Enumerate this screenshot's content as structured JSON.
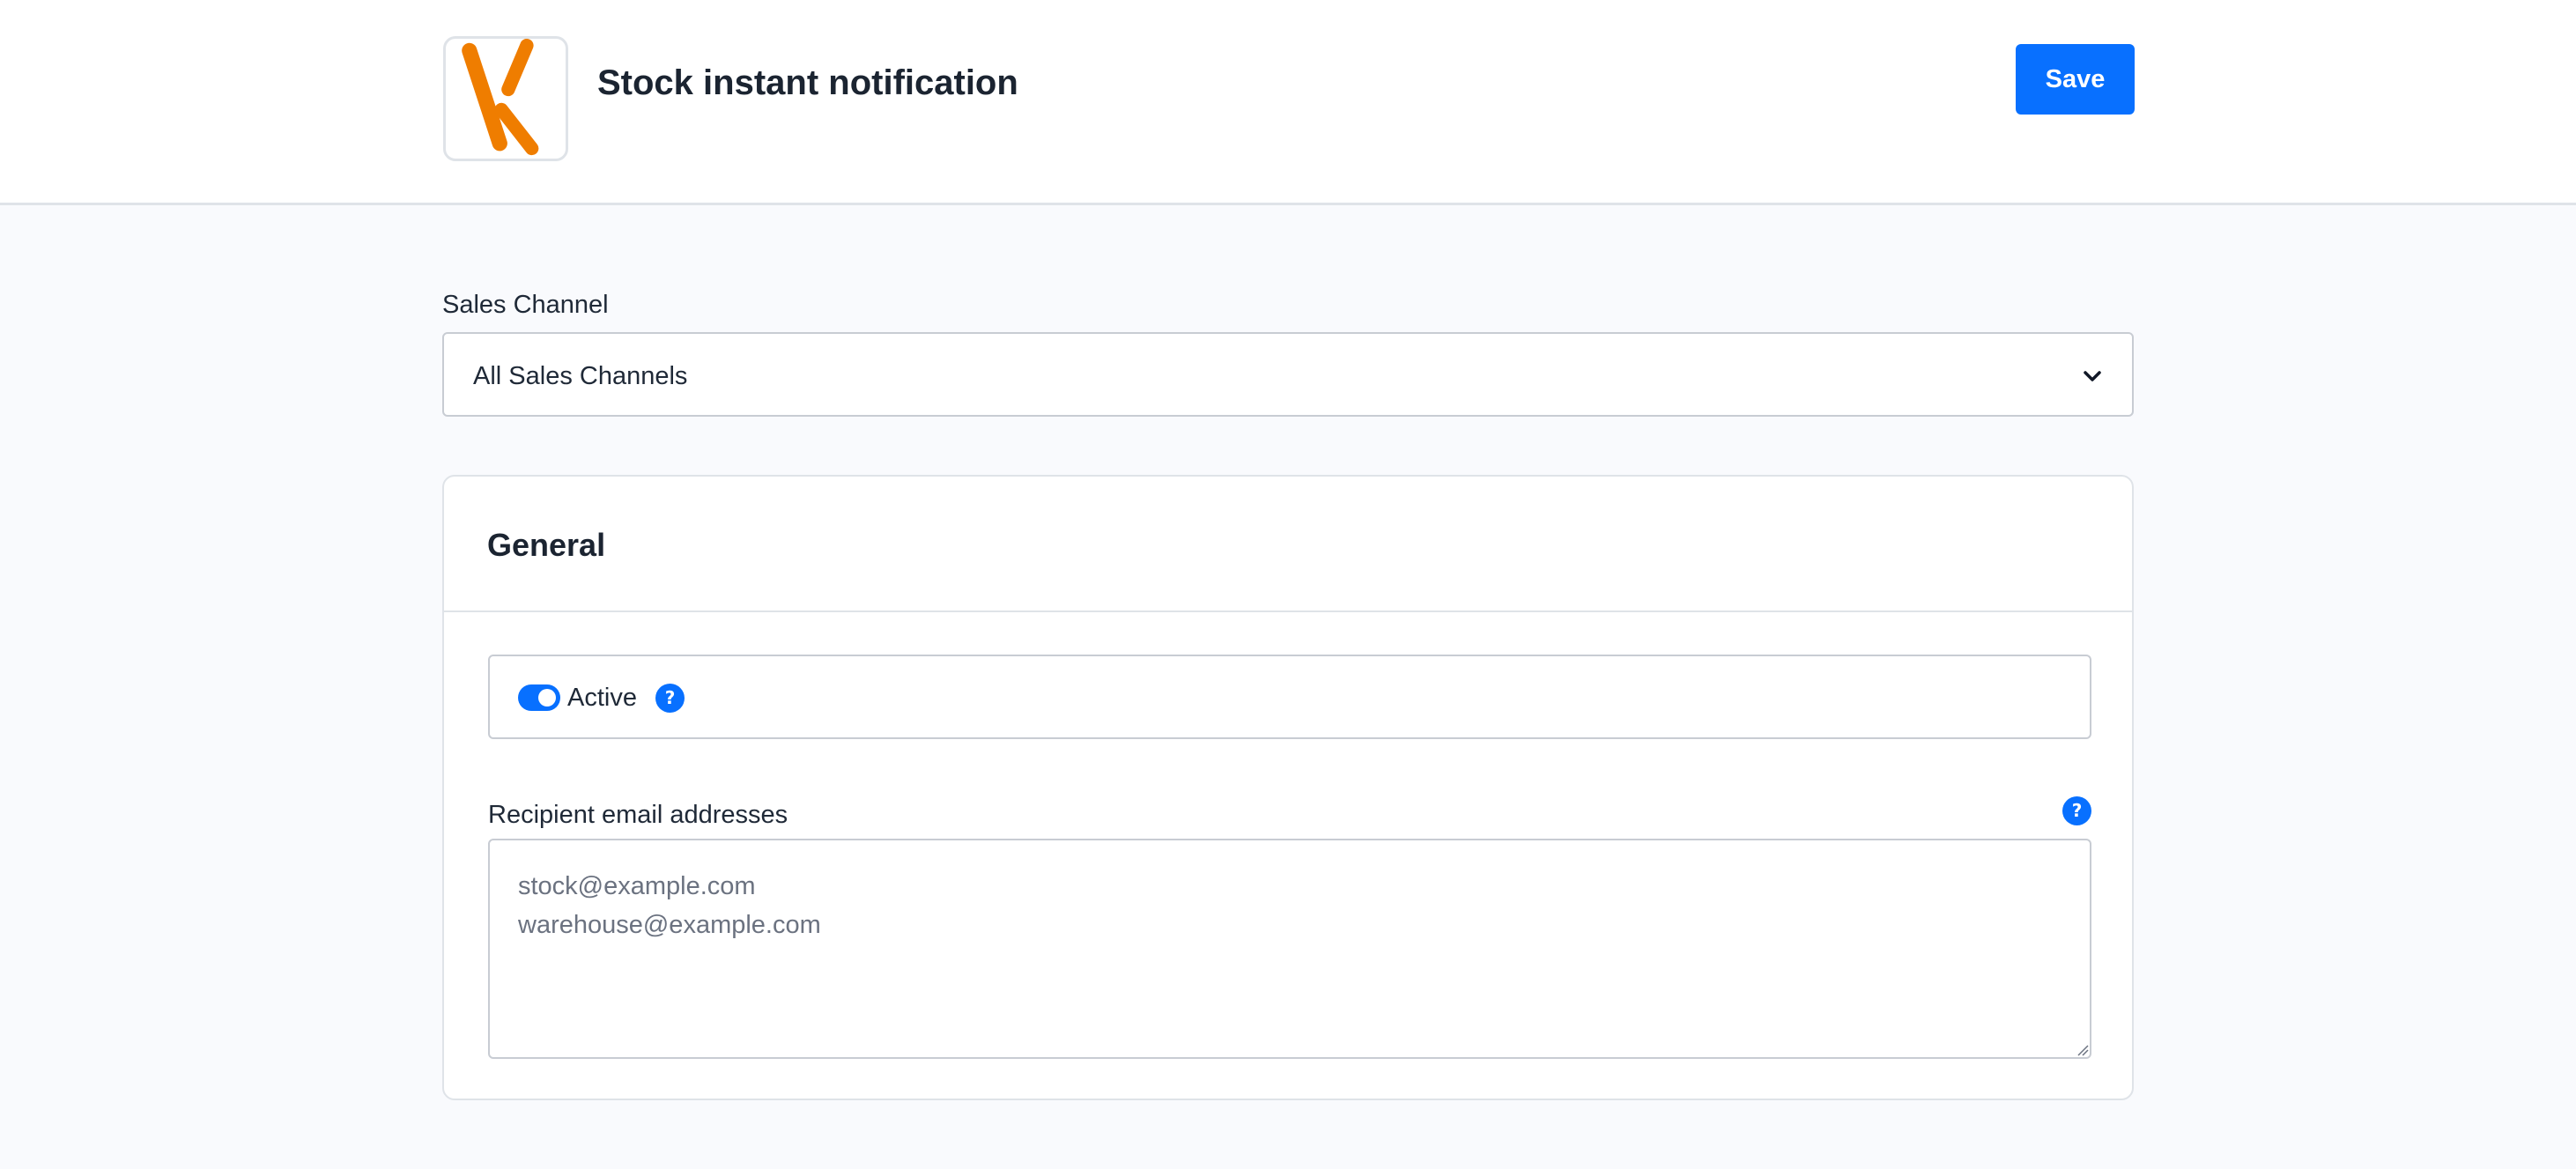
{
  "header": {
    "title": "Stock instant notification",
    "save_label": "Save",
    "logo_icon": "orange-x-logo"
  },
  "sales_channel": {
    "label": "Sales Channel",
    "selected": "All Sales Channels",
    "icon": "chevron-down-icon"
  },
  "general": {
    "title": "General",
    "active_label": "Active",
    "active_checked": true,
    "recipients_label": "Recipient email addresses",
    "recipients_placeholder": "stock@example.com\nwarehouse@example.com",
    "help_glyph": "?"
  },
  "colors": {
    "accent": "#0870ff",
    "logo_orange": "#ef7d00",
    "background": "#f9fafd"
  }
}
